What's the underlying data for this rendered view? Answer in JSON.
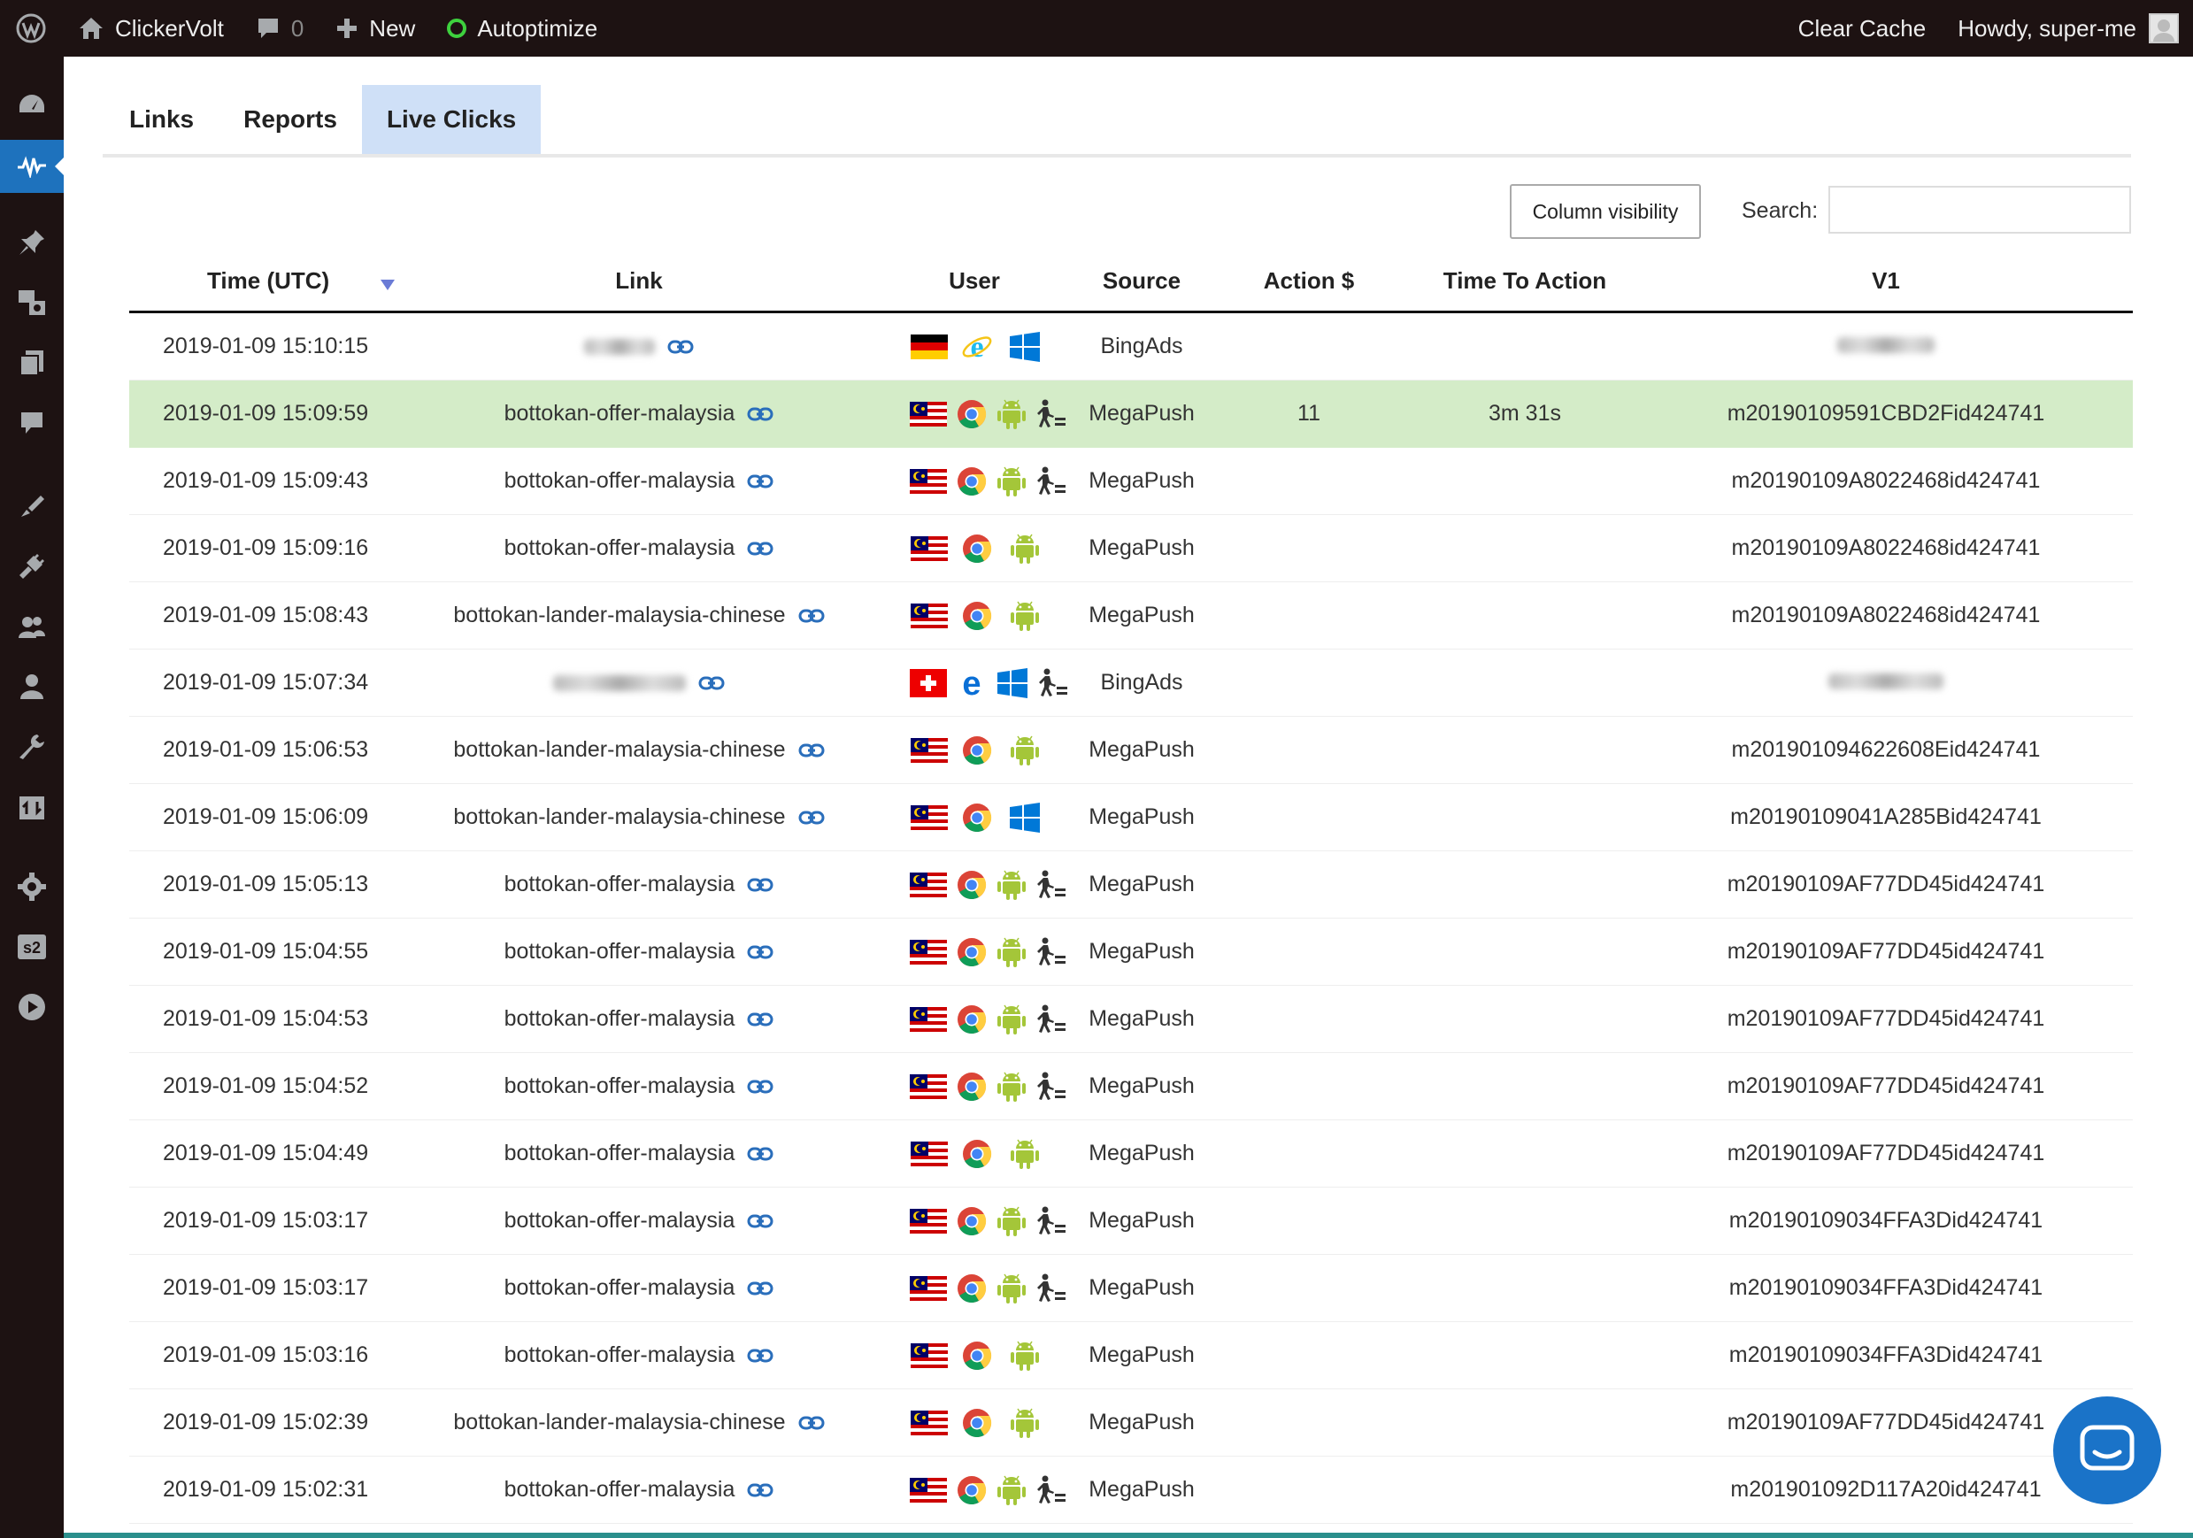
{
  "adminbar": {
    "site_name": "ClickerVolt",
    "comments_count": "0",
    "new_label": "New",
    "autoptimize_label": "Autoptimize",
    "clear_cache_label": "Clear Cache",
    "howdy_label": "Howdy, super-me"
  },
  "tabs": [
    {
      "label": "Links",
      "active": false
    },
    {
      "label": "Reports",
      "active": false
    },
    {
      "label": "Live Clicks",
      "active": true
    }
  ],
  "controls": {
    "column_visibility_label": "Column visibility",
    "search_label": "Search:",
    "search_value": ""
  },
  "table": {
    "headers": [
      "Time (UTC)",
      "Link",
      "User",
      "Source",
      "Action $",
      "Time To Action",
      "V1"
    ],
    "rows": [
      {
        "time": "2019-01-09 15:10:15",
        "link": "",
        "link_blurred": true,
        "flag": "de",
        "browser": "ie",
        "os": "windows",
        "action_icon": false,
        "source": "BingAds",
        "action_value": "",
        "time_to_action": "",
        "v1": "",
        "v1_blurred": true,
        "highlight": false
      },
      {
        "time": "2019-01-09 15:09:59",
        "link": "bottokan-offer-malaysia",
        "link_blurred": false,
        "flag": "my",
        "browser": "chrome",
        "os": "android",
        "action_icon": true,
        "source": "MegaPush",
        "action_value": "11",
        "time_to_action": "3m 31s",
        "v1": "m20190109591CBD2Fid424741",
        "v1_blurred": false,
        "highlight": true
      },
      {
        "time": "2019-01-09 15:09:43",
        "link": "bottokan-offer-malaysia",
        "link_blurred": false,
        "flag": "my",
        "browser": "chrome",
        "os": "android",
        "action_icon": true,
        "source": "MegaPush",
        "action_value": "",
        "time_to_action": "",
        "v1": "m20190109A8022468id424741",
        "v1_blurred": false,
        "highlight": false
      },
      {
        "time": "2019-01-09 15:09:16",
        "link": "bottokan-offer-malaysia",
        "link_blurred": false,
        "flag": "my",
        "browser": "chrome",
        "os": "android",
        "action_icon": false,
        "source": "MegaPush",
        "action_value": "",
        "time_to_action": "",
        "v1": "m20190109A8022468id424741",
        "v1_blurred": false,
        "highlight": false
      },
      {
        "time": "2019-01-09 15:08:43",
        "link": "bottokan-lander-malaysia-chinese",
        "link_blurred": false,
        "flag": "my",
        "browser": "chrome",
        "os": "android",
        "action_icon": false,
        "source": "MegaPush",
        "action_value": "",
        "time_to_action": "",
        "v1": "m20190109A8022468id424741",
        "v1_blurred": false,
        "highlight": false
      },
      {
        "time": "2019-01-09 15:07:34",
        "link": "",
        "link_blurred": true,
        "flag": "ch",
        "browser": "edge",
        "os": "windows",
        "action_icon": true,
        "source": "BingAds",
        "action_value": "",
        "time_to_action": "",
        "v1": "",
        "v1_blurred": true,
        "highlight": false
      },
      {
        "time": "2019-01-09 15:06:53",
        "link": "bottokan-lander-malaysia-chinese",
        "link_blurred": false,
        "flag": "my",
        "browser": "chrome",
        "os": "android",
        "action_icon": false,
        "source": "MegaPush",
        "action_value": "",
        "time_to_action": "",
        "v1": "m201901094622608Eid424741",
        "v1_blurred": false,
        "highlight": false
      },
      {
        "time": "2019-01-09 15:06:09",
        "link": "bottokan-lander-malaysia-chinese",
        "link_blurred": false,
        "flag": "my",
        "browser": "chrome",
        "os": "windows",
        "action_icon": false,
        "source": "MegaPush",
        "action_value": "",
        "time_to_action": "",
        "v1": "m20190109041A285Bid424741",
        "v1_blurred": false,
        "highlight": false
      },
      {
        "time": "2019-01-09 15:05:13",
        "link": "bottokan-offer-malaysia",
        "link_blurred": false,
        "flag": "my",
        "browser": "chrome",
        "os": "android",
        "action_icon": true,
        "source": "MegaPush",
        "action_value": "",
        "time_to_action": "",
        "v1": "m20190109AF77DD45id424741",
        "v1_blurred": false,
        "highlight": false
      },
      {
        "time": "2019-01-09 15:04:55",
        "link": "bottokan-offer-malaysia",
        "link_blurred": false,
        "flag": "my",
        "browser": "chrome",
        "os": "android",
        "action_icon": true,
        "source": "MegaPush",
        "action_value": "",
        "time_to_action": "",
        "v1": "m20190109AF77DD45id424741",
        "v1_blurred": false,
        "highlight": false
      },
      {
        "time": "2019-01-09 15:04:53",
        "link": "bottokan-offer-malaysia",
        "link_blurred": false,
        "flag": "my",
        "browser": "chrome",
        "os": "android",
        "action_icon": true,
        "source": "MegaPush",
        "action_value": "",
        "time_to_action": "",
        "v1": "m20190109AF77DD45id424741",
        "v1_blurred": false,
        "highlight": false
      },
      {
        "time": "2019-01-09 15:04:52",
        "link": "bottokan-offer-malaysia",
        "link_blurred": false,
        "flag": "my",
        "browser": "chrome",
        "os": "android",
        "action_icon": true,
        "source": "MegaPush",
        "action_value": "",
        "time_to_action": "",
        "v1": "m20190109AF77DD45id424741",
        "v1_blurred": false,
        "highlight": false
      },
      {
        "time": "2019-01-09 15:04:49",
        "link": "bottokan-offer-malaysia",
        "link_blurred": false,
        "flag": "my",
        "browser": "chrome",
        "os": "android",
        "action_icon": false,
        "source": "MegaPush",
        "action_value": "",
        "time_to_action": "",
        "v1": "m20190109AF77DD45id424741",
        "v1_blurred": false,
        "highlight": false
      },
      {
        "time": "2019-01-09 15:03:17",
        "link": "bottokan-offer-malaysia",
        "link_blurred": false,
        "flag": "my",
        "browser": "chrome",
        "os": "android",
        "action_icon": true,
        "source": "MegaPush",
        "action_value": "",
        "time_to_action": "",
        "v1": "m20190109034FFA3Did424741",
        "v1_blurred": false,
        "highlight": false
      },
      {
        "time": "2019-01-09 15:03:17",
        "link": "bottokan-offer-malaysia",
        "link_blurred": false,
        "flag": "my",
        "browser": "chrome",
        "os": "android",
        "action_icon": true,
        "source": "MegaPush",
        "action_value": "",
        "time_to_action": "",
        "v1": "m20190109034FFA3Did424741",
        "v1_blurred": false,
        "highlight": false
      },
      {
        "time": "2019-01-09 15:03:16",
        "link": "bottokan-offer-malaysia",
        "link_blurred": false,
        "flag": "my",
        "browser": "chrome",
        "os": "android",
        "action_icon": false,
        "source": "MegaPush",
        "action_value": "",
        "time_to_action": "",
        "v1": "m20190109034FFA3Did424741",
        "v1_blurred": false,
        "highlight": false
      },
      {
        "time": "2019-01-09 15:02:39",
        "link": "bottokan-lander-malaysia-chinese",
        "link_blurred": false,
        "flag": "my",
        "browser": "chrome",
        "os": "android",
        "action_icon": false,
        "source": "MegaPush",
        "action_value": "",
        "time_to_action": "",
        "v1": "m20190109AF77DD45id424741",
        "v1_blurred": false,
        "highlight": false
      },
      {
        "time": "2019-01-09 15:02:31",
        "link": "bottokan-offer-malaysia",
        "link_blurred": false,
        "flag": "my",
        "browser": "chrome",
        "os": "android",
        "action_icon": true,
        "source": "MegaPush",
        "action_value": "",
        "time_to_action": "",
        "v1": "m201901092D117A20id424741",
        "v1_blurred": false,
        "highlight": false
      }
    ]
  },
  "colors": {
    "adminbar_bg": "#1d1212",
    "active_tab_bg": "#cfe0f7",
    "highlight_row_bg": "#d4ecc8",
    "link_icon": "#2a6ebb",
    "chat_button": "#1a73c8",
    "sidebar_active": "#1e72bd"
  },
  "sidebar_icons": [
    "dashboard-icon",
    "clickervolt-pulse-icon",
    "posts-pin-icon",
    "media-icon",
    "pages-icon",
    "comments-icon",
    "appearance-brush-icon",
    "plugins-icon",
    "users-group-icon",
    "user-icon",
    "tools-wrench-icon",
    "import-export-icon",
    "settings-gear-icon",
    "s2-icon",
    "play-circle-icon"
  ]
}
